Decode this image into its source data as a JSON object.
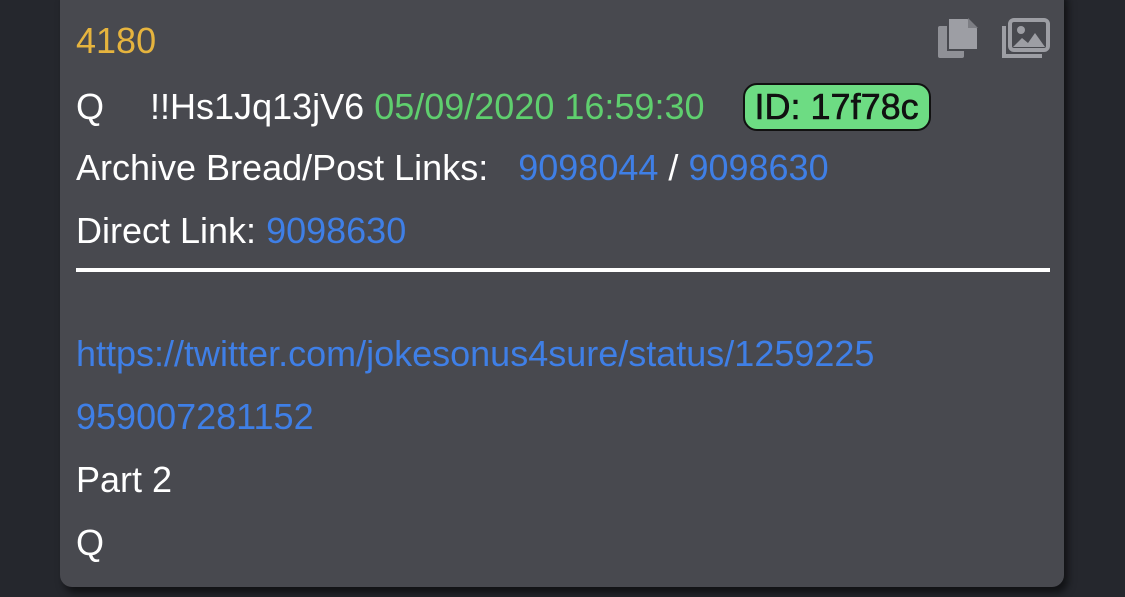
{
  "post": {
    "number": "4180",
    "author": "Q",
    "tripcode": "!!Hs1Jq13jV6",
    "datetime": "05/09/2020 16:59:30",
    "id_badge": "ID: 17f78c",
    "archive_label": "Archive Bread/Post Links:",
    "archive_bread_link": "9098044",
    "archive_separator": "/",
    "archive_post_link": "9098630",
    "direct_label": "Direct Link:",
    "direct_link": "9098630",
    "body_url_line1": "https://twitter.com/jokesonus4sure/status/1259225",
    "body_url_line2": "959007281152",
    "body_line3": "Part 2",
    "body_line4": "Q"
  },
  "icons": {
    "copy": "copy-icon",
    "image": "images-icon"
  },
  "colors": {
    "background": "#25272d",
    "card": "#48494f",
    "post_number": "#e6b43e",
    "date": "#5fcf6e",
    "link": "#3f7fe6",
    "id_badge": "#6ddc83"
  }
}
